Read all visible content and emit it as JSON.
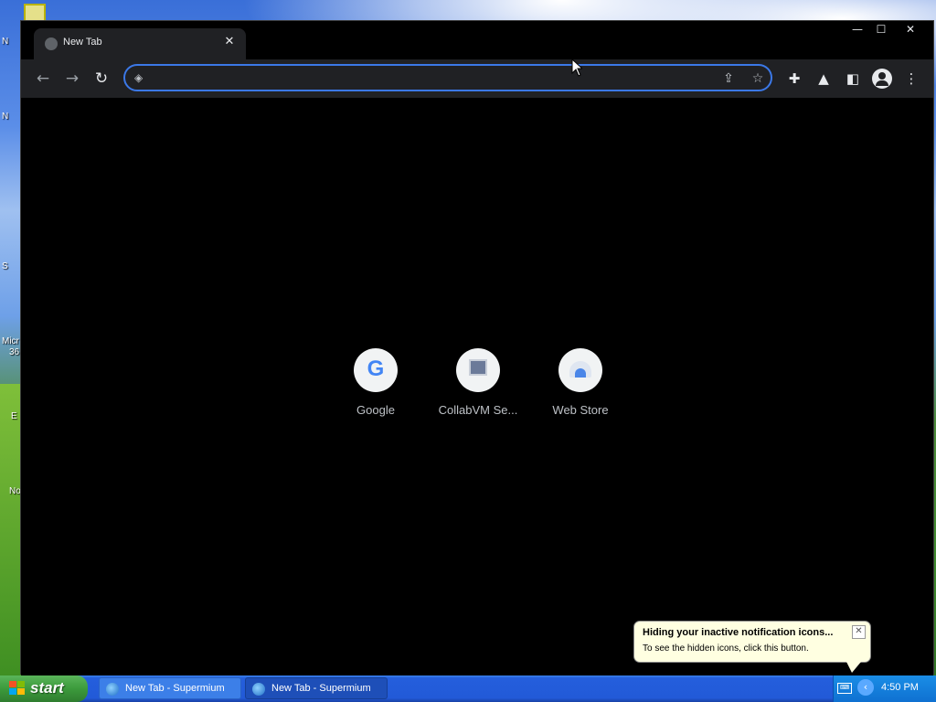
{
  "desktop": {
    "icon_fragments": [
      "N",
      "N",
      "S",
      "Micr",
      "36",
      "E",
      "No"
    ]
  },
  "browser": {
    "tab": {
      "title": "New Tab",
      "close": "✕"
    },
    "window_controls": {
      "minimize": "—",
      "maximize": "☐",
      "close": "✕"
    },
    "toolbar": {
      "back": "←",
      "forward": "→",
      "reload": "↻",
      "omnibox_value": "",
      "omnibox_placeholder": ""
    },
    "shortcuts": [
      {
        "label": "Google",
        "icon": "google-icon"
      },
      {
        "label": "CollabVM Se...",
        "icon": "computer-icon"
      },
      {
        "label": "Web Store",
        "icon": "web-store-icon"
      }
    ],
    "theme": {
      "accent": "#3b78e7",
      "background": "#000000",
      "toolbar": "#202124"
    }
  },
  "notification": {
    "title": "Hiding your inactive notification icons...",
    "text": "To see the hidden icons, click this button."
  },
  "taskbar": {
    "start_label": "start",
    "tasks": [
      {
        "label": "New Tab - Supermium",
        "active": false
      },
      {
        "label": "New Tab - Supermium",
        "active": true
      }
    ],
    "clock": "4:50 PM"
  }
}
